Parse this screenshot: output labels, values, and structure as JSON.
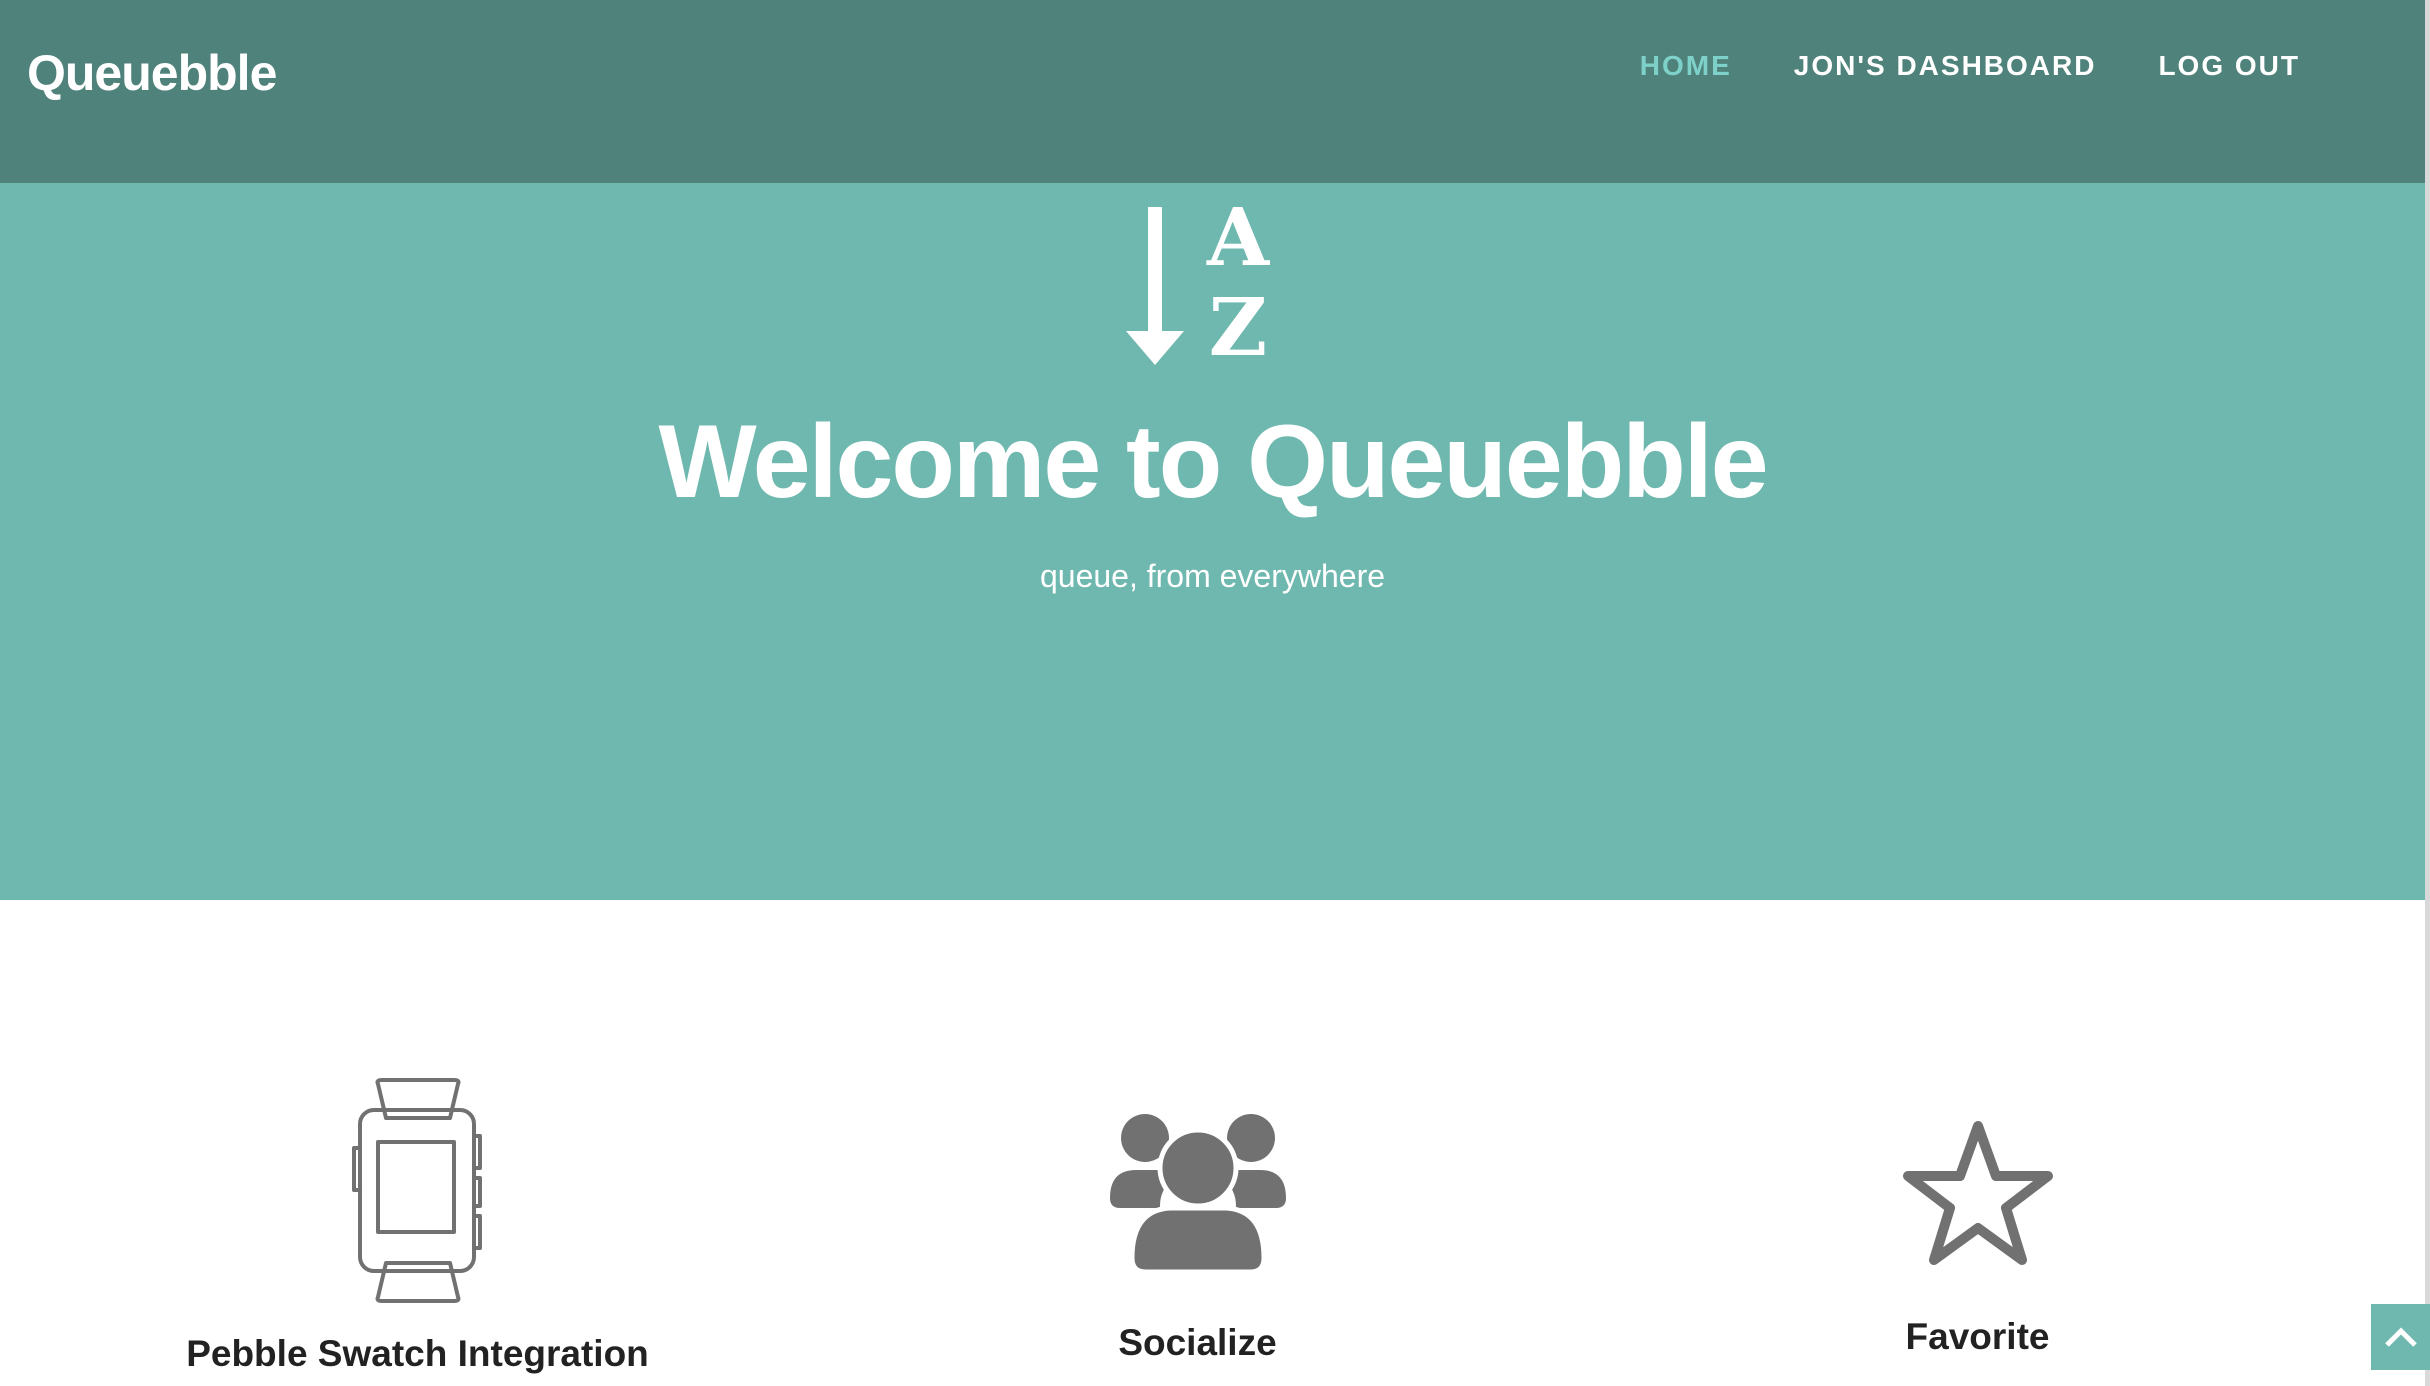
{
  "brand": "Queuebble",
  "nav": {
    "items": [
      {
        "label": "HOME",
        "active": true
      },
      {
        "label": "JON'S DASHBOARD",
        "active": false
      },
      {
        "label": "LOG OUT",
        "active": false
      }
    ]
  },
  "hero": {
    "icon": "sort-alpha-down-icon",
    "title": "Welcome to Queuebble",
    "subtitle": "queue, from everywhere"
  },
  "features": [
    {
      "icon": "pebble-watch-icon",
      "title": "Pebble Swatch Integration"
    },
    {
      "icon": "users-icon",
      "title": "Socialize"
    },
    {
      "icon": "star-icon",
      "title": "Favorite"
    }
  ],
  "back_to_top": {
    "icon": "chevron-up-icon"
  },
  "colors": {
    "navbar": "#4f827b",
    "hero": "#6fb8af",
    "active_link": "#7ed1c8",
    "icon_gray": "#717171"
  }
}
